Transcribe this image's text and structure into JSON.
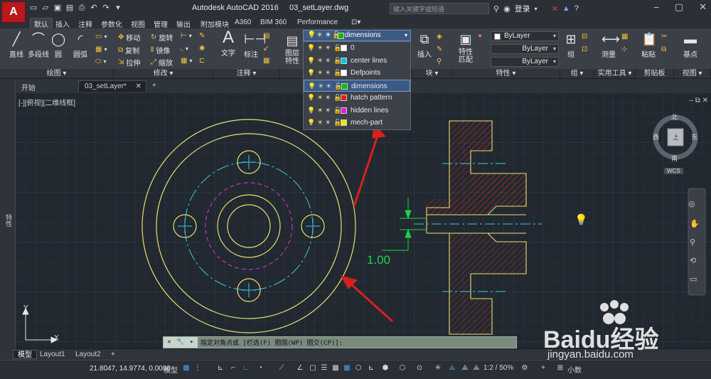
{
  "title_bar": {
    "app_name": "Autodesk AutoCAD 2016",
    "file_name": "03_setLayer.dwg",
    "search_placeholder": "键入关键字或短语",
    "login_label": "登录",
    "logo_letter": "A"
  },
  "ribbon_tabs": [
    "默认",
    "插入",
    "注释",
    "参数化",
    "视图",
    "管理",
    "输出",
    "附加模块",
    "A360",
    "BIM 360",
    "Performance"
  ],
  "ribbon": {
    "draw": {
      "group": "绘图",
      "line": "直线",
      "polyline": "多段线",
      "circle": "圆",
      "arc": "圆弧"
    },
    "modify": {
      "group": "修改",
      "move": "移动",
      "rotate": "旋转",
      "copy": "复制",
      "mirror": "镜像",
      "stretch": "拉伸",
      "scale": "缩放"
    },
    "annotation": {
      "group": "注释",
      "text": "文字",
      "dimension": "标注"
    },
    "layers": {
      "properties": "图层特性"
    },
    "block": {
      "group": "块",
      "insert": "插入"
    },
    "properties": {
      "group": "特性",
      "match": "特性匹配",
      "color": "ByLayer",
      "linetype": "ByLayer",
      "lineweight": "ByLayer"
    },
    "groups": {
      "group": "组",
      "label": "组"
    },
    "utilities": {
      "group": "实用工具",
      "measure": "测量"
    },
    "clipboard": {
      "group": "剪贴板",
      "paste": "粘贴"
    },
    "view": {
      "group": "视图",
      "basepoint": "基点"
    }
  },
  "layer_dropdown": {
    "current": {
      "name": "dimensions",
      "color": "#00c000"
    },
    "layers": [
      {
        "name": "0",
        "color": "#ffffff"
      },
      {
        "name": "center lines",
        "color": "#00c8e6"
      },
      {
        "name": "Defpoints",
        "color": "#ffffff"
      },
      {
        "name": "dimensions",
        "color": "#00c000",
        "selected": true
      },
      {
        "name": "hatch pattern",
        "color": "#e0201c"
      },
      {
        "name": "hidden lines",
        "color": "#e020c8"
      },
      {
        "name": "mech-part",
        "color": "#f0e800"
      }
    ]
  },
  "doc_tabs": [
    "开始",
    "03_setLayer*"
  ],
  "viewport": {
    "label": "[-][俯视][二维线框]",
    "side_palette": "特性",
    "viewcube": {
      "north": "北",
      "south": "南",
      "west": "西",
      "east": "东",
      "face": "上",
      "wcs": "WCS"
    },
    "ucs_x": "X",
    "ucs_y": "Y"
  },
  "drawing": {
    "dimension_text": "1.00"
  },
  "command_line": {
    "text": "指定对角点或 [栏选(F) 圈围(WP) 圈交(CP)]:"
  },
  "layout_tabs": [
    "模型",
    "Layout1",
    "Layout2"
  ],
  "status_bar": {
    "coords": "21.8047, 14.9774, 0.0000",
    "model": "模型",
    "scale": "1:2 / 50%",
    "units": "小数"
  },
  "watermark": {
    "brand": "Baidu经验",
    "url": "jingyan.baidu.com"
  }
}
